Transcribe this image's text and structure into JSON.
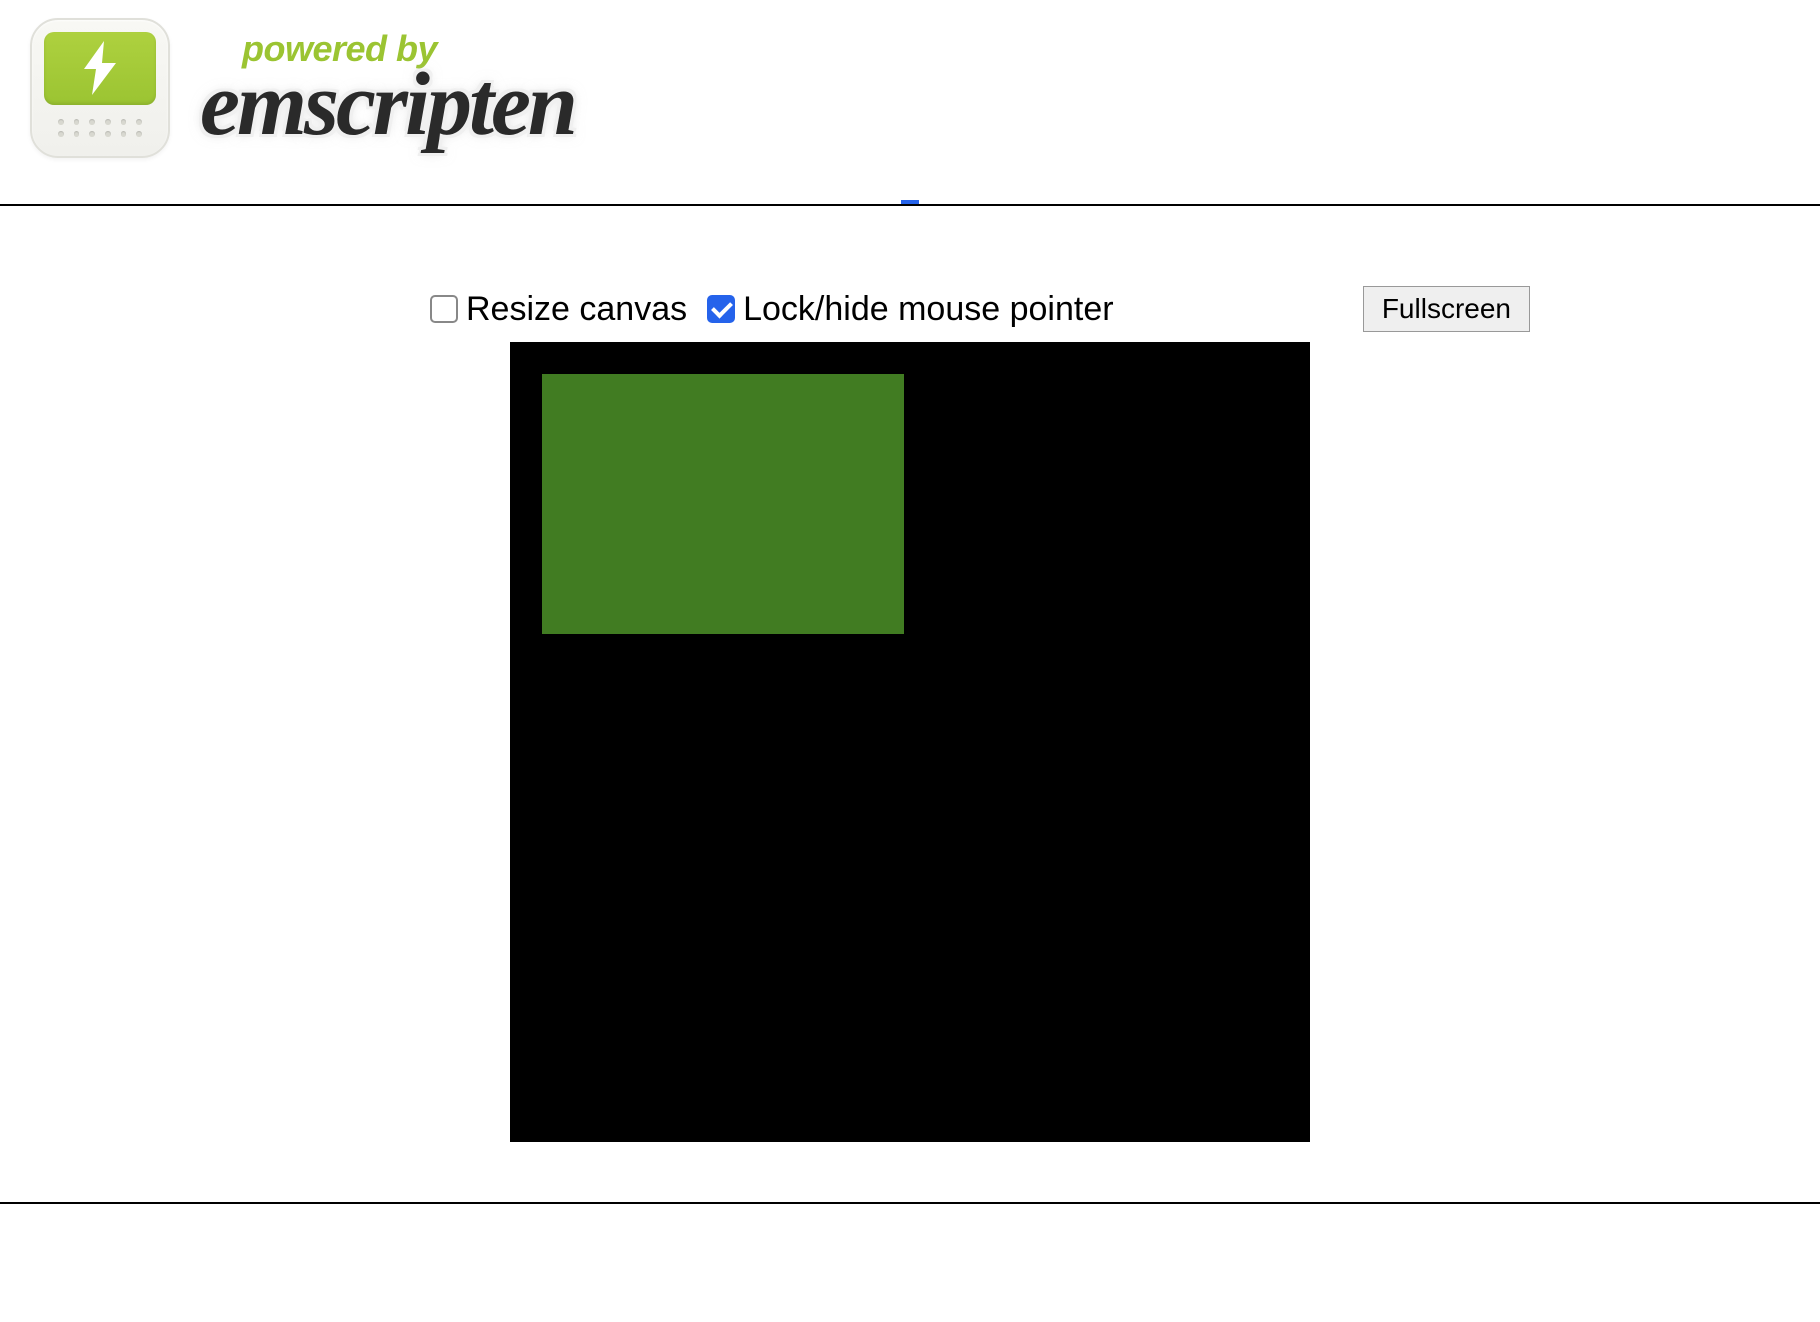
{
  "header": {
    "powered_by": "powered by",
    "brand": "emscripten"
  },
  "controls": {
    "resize_canvas_label": "Resize canvas",
    "resize_canvas_checked": false,
    "lock_pointer_label": "Lock/hide mouse pointer",
    "lock_pointer_checked": true,
    "fullscreen_label": "Fullscreen"
  },
  "canvas": {
    "bg_color": "#000000",
    "rect_color": "#417c22"
  }
}
